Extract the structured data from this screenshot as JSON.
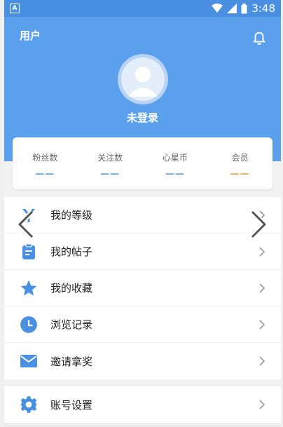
{
  "status_bar": {
    "time": "3:48",
    "app_badge": "A"
  },
  "header": {
    "title": "用户",
    "login_text": "未登录"
  },
  "stats": [
    {
      "label": "粉丝数",
      "value": "——",
      "color": "#5aa0ec"
    },
    {
      "label": "关注数",
      "value": "——",
      "color": "#5aa0ec"
    },
    {
      "label": "心星币",
      "value": "——",
      "color": "#5aa0ec"
    },
    {
      "label": "会员",
      "value": "——",
      "color": "#f0a04b"
    }
  ],
  "menu": [
    {
      "label": "我的等级",
      "icon": "level-icon"
    },
    {
      "label": "我的帖子",
      "icon": "posts-icon"
    },
    {
      "label": "我的收藏",
      "icon": "star-icon"
    },
    {
      "label": "浏览记录",
      "icon": "clock-icon"
    },
    {
      "label": "邀请拿奖",
      "icon": "mail-icon"
    }
  ],
  "settings": {
    "label": "账号设置",
    "icon": "gear-icon"
  },
  "colors": {
    "primary": "#5aa0ec",
    "accent": "#f0a04b"
  }
}
